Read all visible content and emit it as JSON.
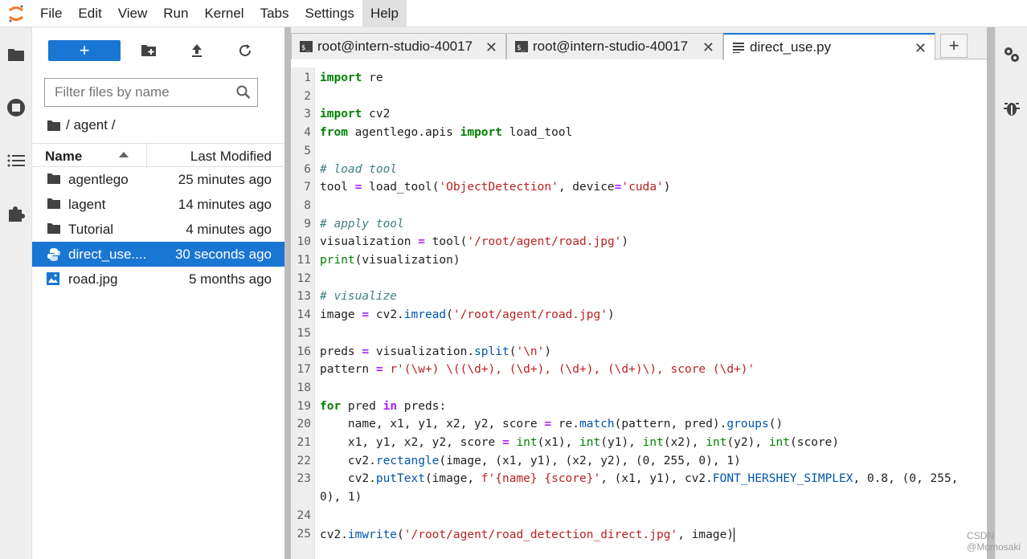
{
  "menu": [
    "File",
    "Edit",
    "View",
    "Run",
    "Kernel",
    "Tabs",
    "Settings",
    "Help"
  ],
  "new_button_label": "+",
  "filter_placeholder": "Filter files by name",
  "breadcrumb": "/ agent /",
  "columns": {
    "name": "Name",
    "modified": "Last Modified"
  },
  "files": [
    {
      "name": "agentlego",
      "modified": "25 minutes ago",
      "type": "folder-icon"
    },
    {
      "name": "lagent",
      "modified": "14 minutes ago",
      "type": "folder-icon"
    },
    {
      "name": "Tutorial",
      "modified": "4 minutes ago",
      "type": "folder-icon"
    },
    {
      "name": "direct_use....",
      "modified": "30 seconds ago",
      "type": "python-file-icon",
      "selected": true
    },
    {
      "name": "road.jpg",
      "modified": "5 months ago",
      "type": "image-file-icon"
    }
  ],
  "tabs": [
    {
      "label": "root@intern-studio-40017",
      "close": "✕",
      "type": "terminal-icon"
    },
    {
      "label": "root@intern-studio-40017",
      "close": "✕",
      "type": "terminal-icon"
    },
    {
      "label": "direct_use.py",
      "close": "✕",
      "type": "text-file-icon",
      "active": true
    }
  ],
  "add_tab_label": "+",
  "code_lines": [
    {
      "n": "1",
      "text": "import re"
    },
    {
      "n": "2",
      "text": ""
    },
    {
      "n": "3",
      "text": "import cv2"
    },
    {
      "n": "4",
      "text": "from agentlego.apis import load_tool"
    },
    {
      "n": "5",
      "text": ""
    },
    {
      "n": "6",
      "text": "# load tool"
    },
    {
      "n": "7",
      "text": "tool = load_tool('ObjectDetection', device='cuda')"
    },
    {
      "n": "8",
      "text": ""
    },
    {
      "n": "9",
      "text": "# apply tool"
    },
    {
      "n": "10",
      "text": "visualization = tool('/root/agent/road.jpg')"
    },
    {
      "n": "11",
      "text": "print(visualization)"
    },
    {
      "n": "12",
      "text": ""
    },
    {
      "n": "13",
      "text": "# visualize"
    },
    {
      "n": "14",
      "text": "image = cv2.imread('/root/agent/road.jpg')"
    },
    {
      "n": "15",
      "text": ""
    },
    {
      "n": "16",
      "text": "preds = visualization.split('\\n')"
    },
    {
      "n": "17",
      "text": "pattern = r'(\\w+) \\((\\d+), (\\d+), (\\d+), (\\d+)\\), score (\\d+)'"
    },
    {
      "n": "18",
      "text": ""
    },
    {
      "n": "19",
      "text": "for pred in preds:"
    },
    {
      "n": "20",
      "text": "    name, x1, y1, x2, y2, score = re.match(pattern, pred).groups()"
    },
    {
      "n": "21",
      "text": "    x1, y1, x2, y2, score = int(x1), int(y1), int(x2), int(y2), int(score)"
    },
    {
      "n": "22",
      "text": "    cv2.rectangle(image, (x1, y1), (x2, y2), (0, 255, 0), 1)"
    },
    {
      "n": "23",
      "text": "    cv2.putText(image, f'{name} {score}', (x1, y1), cv2.FONT_HERSHEY_SIMPLEX, 0.8, (0, 255,"
    },
    {
      "n": "",
      "text": "0), 1)"
    },
    {
      "n": "24",
      "text": ""
    },
    {
      "n": "25",
      "text": "cv2.imwrite('/root/agent/road_detection_direct.jpg', image)"
    }
  ],
  "watermark": "CSDN @Momosaki",
  "colors": {
    "accent": "#1976d2",
    "keyword": "#008000",
    "string": "#ba2121",
    "comment": "#408080"
  }
}
